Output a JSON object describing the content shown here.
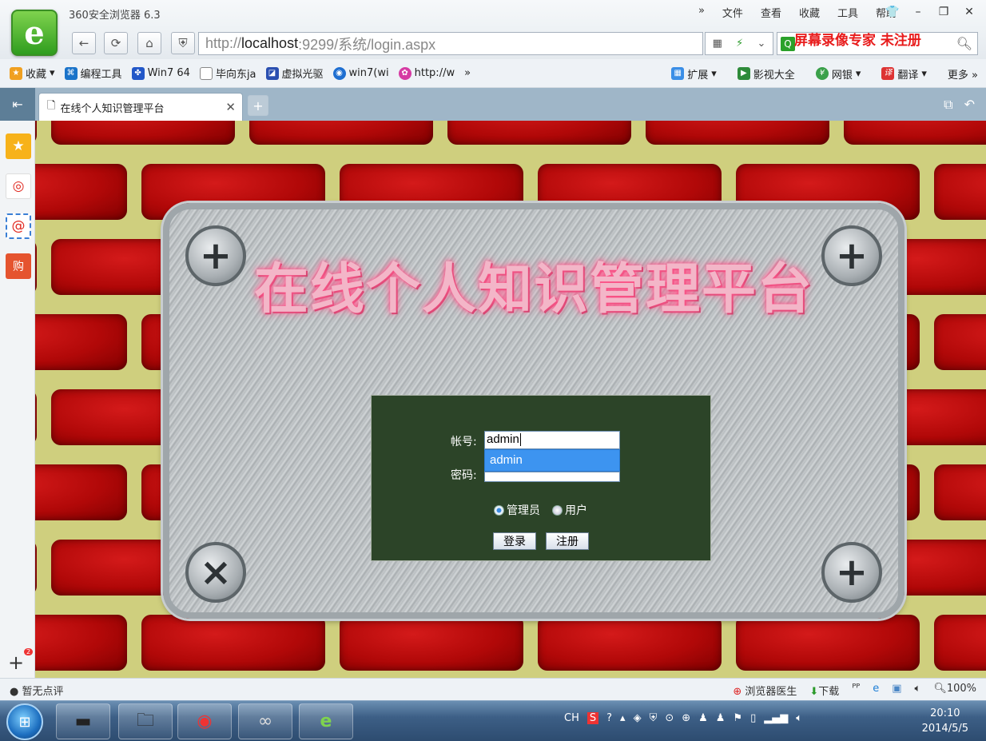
{
  "browser": {
    "app_title": "360安全浏览器 6.3",
    "menus": [
      "»",
      "文件",
      "查看",
      "收藏",
      "工具",
      "帮助"
    ],
    "url_prefix": "http://",
    "url_host": "localhost",
    "url_rest": ":9299/系统/login.aspx",
    "watermark": "屏幕录像专家  未注册"
  },
  "favorites": {
    "items": [
      "收藏",
      "编程工具",
      "Win7 64",
      "毕向东ja",
      "虚拟光驱",
      "win7(wi",
      "http://w",
      "»"
    ],
    "right": [
      "扩展",
      "影视大全",
      "网银",
      "翻译",
      "更多 »"
    ]
  },
  "tab": {
    "title": "在线个人知识管理平台"
  },
  "page": {
    "headline": "在线个人知识管理平台",
    "account_label": "帐号:",
    "account_value": "admin",
    "password_label": "密码:",
    "autocomplete_option": "admin",
    "role_admin": "管理员",
    "role_user": "用户",
    "selected_role": "admin",
    "login_button": "登录",
    "register_button": "注册"
  },
  "statusbar": {
    "left": "暂无点评",
    "doctor": "浏览器医生",
    "download": "下载",
    "zoom": "100%"
  },
  "taskbar": {
    "input_method": "CH",
    "time": "20:10",
    "date": "2014/5/5"
  }
}
